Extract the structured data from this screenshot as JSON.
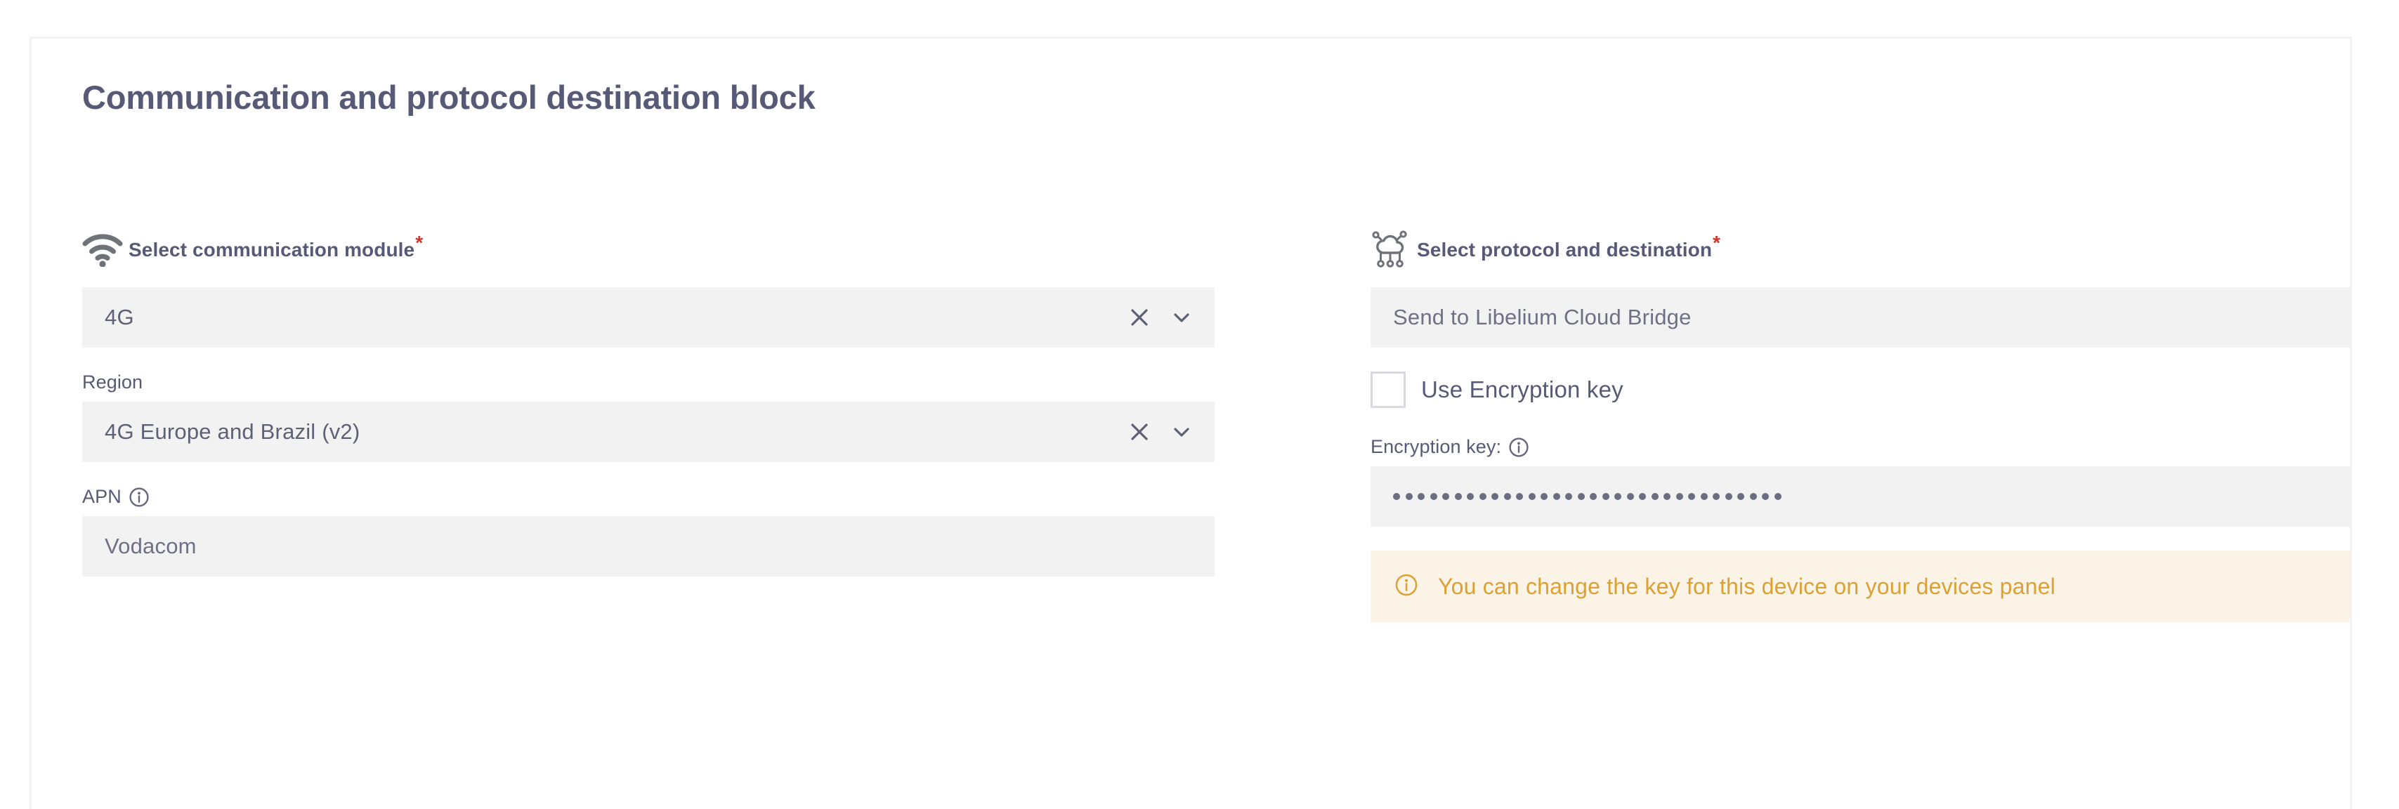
{
  "card": {
    "title": "Communication and protocol destination block"
  },
  "left_column": {
    "heading": {
      "icon": "wifi-icon",
      "label": "Select communication module",
      "required_marker": "*"
    },
    "module_select": {
      "value": "4G",
      "clear_icon": "close-icon",
      "expand_icon": "chevron-down-icon"
    },
    "region": {
      "label": "Region",
      "value": "4G Europe and Brazil (v2)",
      "clear_icon": "close-icon",
      "expand_icon": "chevron-down-icon"
    },
    "apn": {
      "label": "APN",
      "info_icon": "info-icon",
      "value": "Vodacom"
    }
  },
  "right_column": {
    "heading": {
      "icon": "cloud-network-icon",
      "label": "Select protocol and destination",
      "required_marker": "*"
    },
    "protocol_select": {
      "value": "Send to Libelium Cloud Bridge"
    },
    "use_encryption": {
      "label": "Use Encryption key",
      "checked": false
    },
    "encryption_key": {
      "label": "Encryption key:",
      "info_icon": "info-icon",
      "masked_value": "••••••••••••••••••••••••••••••••",
      "dot_count": 32
    },
    "notice": {
      "icon": "info-icon",
      "text": "You can change the key for this device on your devices panel"
    }
  },
  "colors": {
    "text_primary": "#575a77",
    "input_bg": "#f2f2f2",
    "required": "#d0342c",
    "notice_bg": "#fbf3e6",
    "notice_text": "#dba134"
  }
}
